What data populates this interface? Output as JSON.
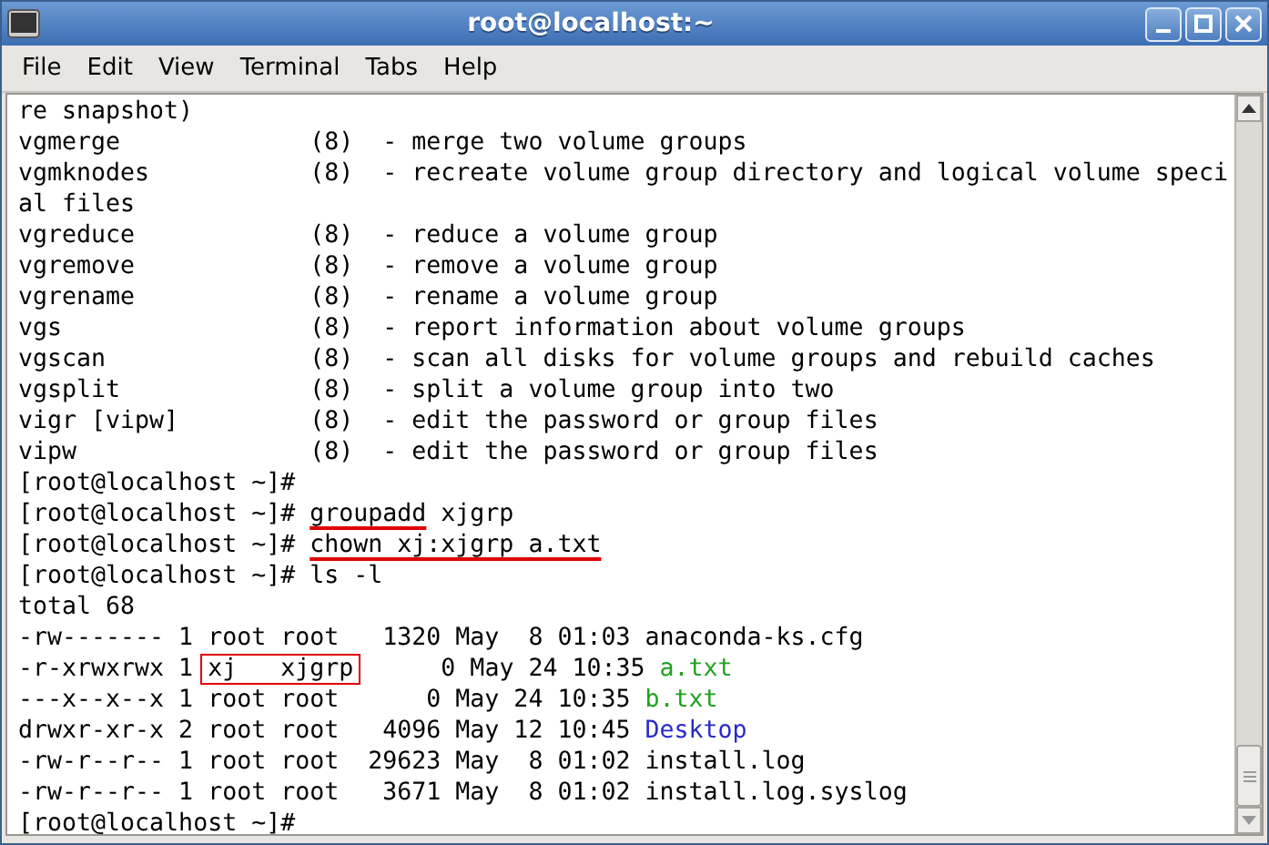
{
  "window": {
    "title": "root@localhost:~"
  },
  "menu": [
    {
      "label": "File"
    },
    {
      "label": "Edit"
    },
    {
      "label": "View"
    },
    {
      "label": "Terminal"
    },
    {
      "label": "Tabs"
    },
    {
      "label": "Help"
    }
  ],
  "terminal": {
    "lines": [
      [
        {
          "text": "re snapshot)"
        }
      ],
      [
        {
          "text": "vgmerge             (8)  - merge two volume groups"
        }
      ],
      [
        {
          "text": "vgmknodes           (8)  - recreate volume group directory and logical volume speci"
        }
      ],
      [
        {
          "text": "al files"
        }
      ],
      [
        {
          "text": "vgreduce            (8)  - reduce a volume group"
        }
      ],
      [
        {
          "text": "vgremove            (8)  - remove a volume group"
        }
      ],
      [
        {
          "text": "vgrename            (8)  - rename a volume group"
        }
      ],
      [
        {
          "text": "vgs                 (8)  - report information about volume groups"
        }
      ],
      [
        {
          "text": "vgscan              (8)  - scan all disks for volume groups and rebuild caches"
        }
      ],
      [
        {
          "text": "vgsplit             (8)  - split a volume group into two"
        }
      ],
      [
        {
          "text": "vigr [vipw]         (8)  - edit the password or group files"
        }
      ],
      [
        {
          "text": "vipw                (8)  - edit the password or group files"
        }
      ],
      [
        {
          "text": "[root@localhost ~]#"
        }
      ],
      [
        {
          "text": "[root@localhost ~]# "
        },
        {
          "text": "groupadd",
          "underlined": true
        },
        {
          "text": " xjgrp"
        }
      ],
      [
        {
          "text": "[root@localhost ~]# "
        },
        {
          "text": "chown xj:xjgrp a.txt",
          "underlined": true
        }
      ],
      [
        {
          "text": "[root@localhost ~]# ls -l"
        }
      ],
      [
        {
          "text": "total 68"
        }
      ],
      [
        {
          "text": "-rw------- 1 root root   1320 May  8 01:03 anaconda-ks.cfg"
        }
      ],
      [
        {
          "text": "-r-xrwxrwx 1 "
        },
        {
          "text": "xj   xjgrp",
          "boxed": true
        },
        {
          "text": "      0 May 24 10:35 "
        },
        {
          "text": "a.txt",
          "color": "#21a121"
        }
      ],
      [
        {
          "text": "---x--x--x 1 root root      0 May 24 10:35 "
        },
        {
          "text": "b.txt",
          "color": "#21a121"
        }
      ],
      [
        {
          "text": "drwxr-xr-x 2 root root   4096 May 12 10:45 "
        },
        {
          "text": "Desktop",
          "color": "#2a2ac8"
        }
      ],
      [
        {
          "text": "-rw-r--r-- 1 root root  29623 May  8 01:02 install.log"
        }
      ],
      [
        {
          "text": "-rw-r--r-- 1 root root   3671 May  8 01:02 install.log.syslog"
        }
      ],
      [
        {
          "text": "[root@localhost ~]#"
        }
      ]
    ]
  }
}
